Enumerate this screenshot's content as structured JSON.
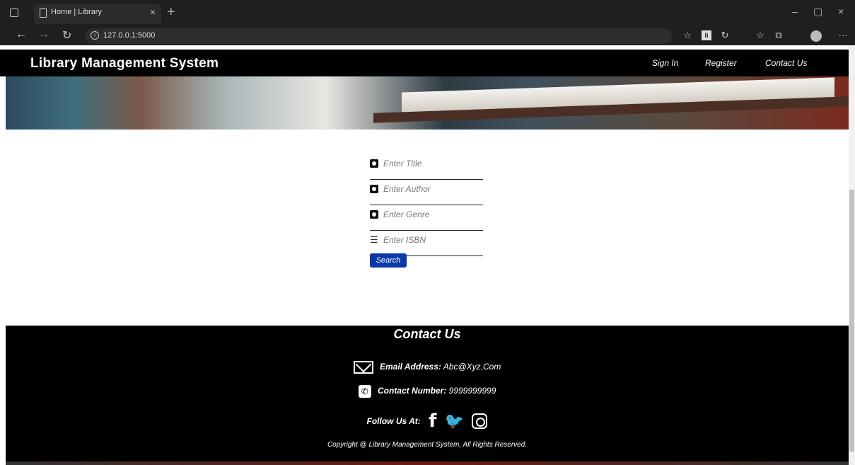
{
  "browser": {
    "tab_title": "Home | Library",
    "tab_close": "×",
    "new_tab": "+",
    "url": "127.0.0.1:5000",
    "window_controls": {
      "minimize": "–",
      "maximize": "▢",
      "close": "×"
    },
    "back_glyph": "←",
    "forward_glyph": "→",
    "reload_glyph": "↻",
    "more_glyph": "···",
    "icons": [
      "favorites-star-icon",
      "extension-icon",
      "refresh-icon",
      "favorites-icon",
      "collections-icon",
      "profile-avatar-icon",
      "more-icon"
    ]
  },
  "navbar": {
    "brand": "Library Management System",
    "links": {
      "sign_in": "Sign In",
      "register": "Register",
      "contact": "Contact Us"
    }
  },
  "search_form": {
    "title_placeholder": "Enter Title",
    "author_placeholder": "Enter Author",
    "genre_placeholder": "Enter Genre",
    "isbn_placeholder": "Enter ISBN",
    "button_label": "Search"
  },
  "footer": {
    "heading": "Contact Us",
    "email_label": "Email Address:",
    "email_value": "Abc@Xyz.Com",
    "phone_label": "Contact Number:",
    "phone_value": "9999999999",
    "follow_label": "Follow Us At:",
    "copyright": "Copyright @ Library Management System, All Rights Reserved."
  },
  "colors": {
    "navbar_bg": "#000000",
    "button_bg": "#0b3aa8",
    "footer_bg": "#000000"
  }
}
